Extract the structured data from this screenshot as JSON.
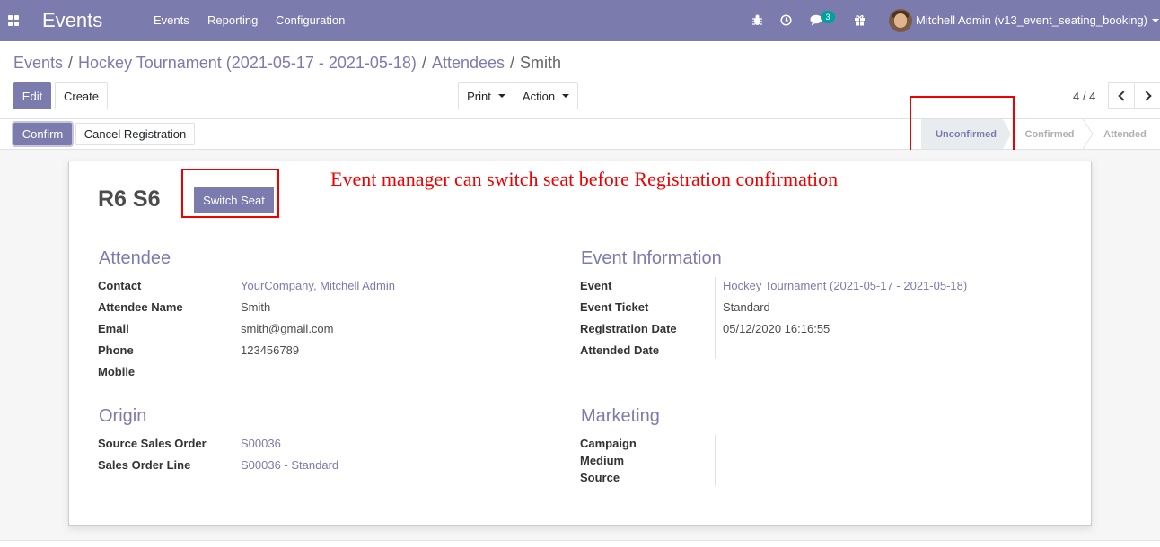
{
  "navbar": {
    "app_name": "Events",
    "menu": [
      "Events",
      "Reporting",
      "Configuration"
    ],
    "messages_count": "3",
    "user": "Mitchell Admin (v13_event_seating_booking)"
  },
  "breadcrumb": {
    "items": [
      "Events",
      "Hockey Tournament (2021-05-17 - 2021-05-18)",
      "Attendees"
    ],
    "current": "Smith"
  },
  "toolbar": {
    "edit": "Edit",
    "create": "Create",
    "print": "Print",
    "action": "Action",
    "pager": "4 / 4"
  },
  "status_bar": {
    "confirm": "Confirm",
    "cancel": "Cancel Registration",
    "stages": [
      "Unconfirmed",
      "Confirmed",
      "Attended"
    ],
    "current_stage": "Unconfirmed"
  },
  "record": {
    "title": "R6 S6",
    "switch_seat": "Switch Seat",
    "annotation": "Event manager can switch seat  before Registration confirmation"
  },
  "attendee": {
    "title": "Attendee",
    "fields": [
      {
        "label": "Contact",
        "value": "YourCompany, Mitchell Admin"
      },
      {
        "label": "Attendee Name",
        "value": "Smith"
      },
      {
        "label": "Email",
        "value": "smith@gmail.com"
      },
      {
        "label": "Phone",
        "value": "123456789"
      },
      {
        "label": "Mobile",
        "value": ""
      }
    ]
  },
  "event_info": {
    "title": "Event Information",
    "fields": [
      {
        "label": "Event",
        "value": "Hockey Tournament (2021-05-17 - 2021-05-18)"
      },
      {
        "label": "Event Ticket",
        "value": "Standard"
      },
      {
        "label": "Registration Date",
        "value": "05/12/2020 16:16:55"
      },
      {
        "label": "Attended Date",
        "value": ""
      }
    ]
  },
  "origin": {
    "title": "Origin",
    "fields": [
      {
        "label": "Source Sales Order",
        "value": "S00036"
      },
      {
        "label": "Sales Order Line",
        "value": "S00036 - Standard"
      }
    ]
  },
  "marketing": {
    "title": "Marketing",
    "fields": [
      {
        "label": "Campaign",
        "value": ""
      },
      {
        "label": "Medium",
        "value": ""
      },
      {
        "label": "Source",
        "value": ""
      }
    ]
  },
  "colors": {
    "brand": "#7c7bad",
    "annotation": "#e00000"
  }
}
